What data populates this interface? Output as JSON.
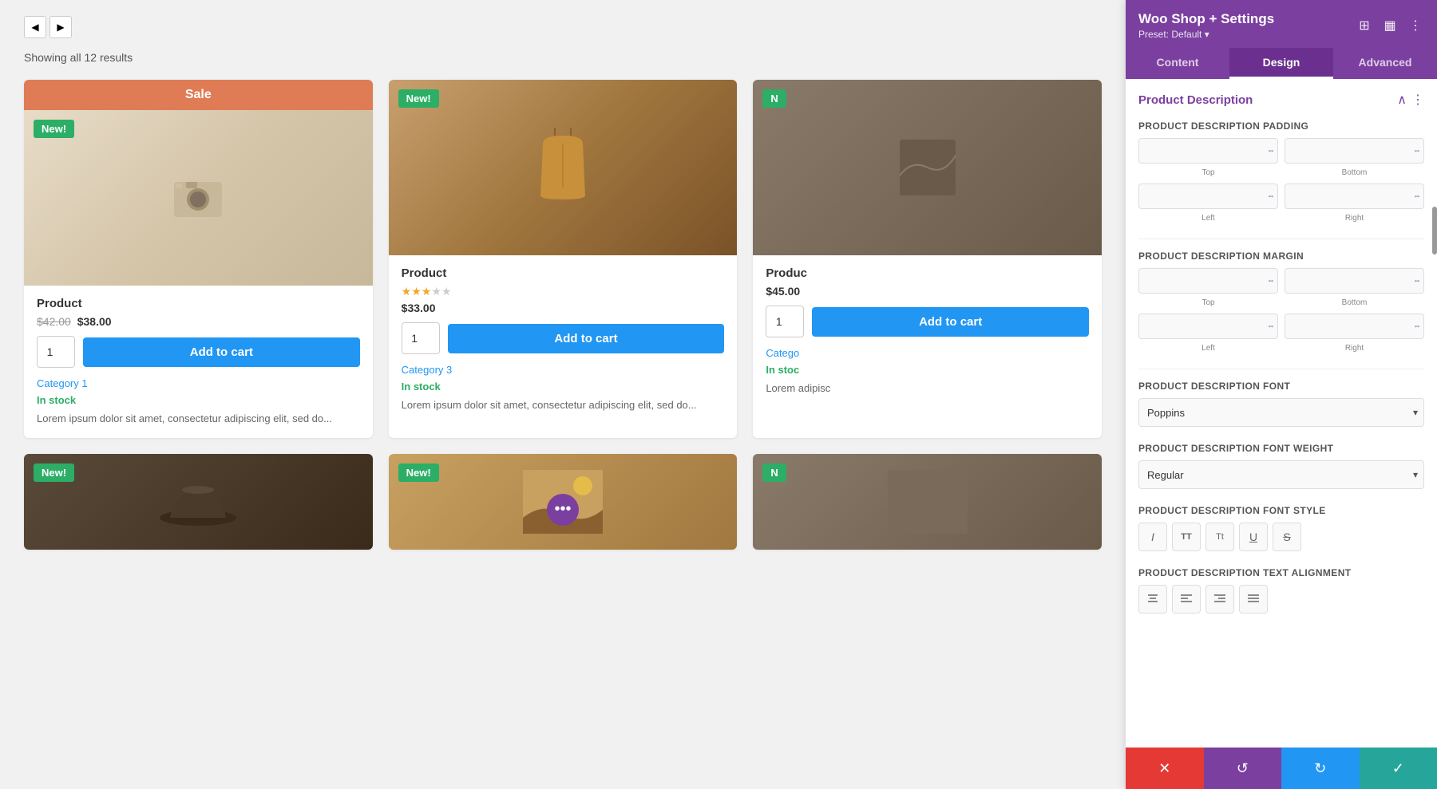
{
  "main": {
    "results_count": "Showing all 12 results",
    "pagination": [
      "◀",
      "▶"
    ]
  },
  "products": [
    {
      "id": "p1",
      "sale_banner": "Sale",
      "badge": "New!",
      "image_type": "camera",
      "name": "Product",
      "old_price": "$42.00",
      "new_price": "$38.00",
      "rating": null,
      "qty": "1",
      "add_to_cart": "Add to cart",
      "category": "Category 1",
      "stock": "In stock",
      "description": "Lorem ipsum dolor sit amet, consectetur adipiscing elit, sed do..."
    },
    {
      "id": "p2",
      "sale_banner": null,
      "badge": "New!",
      "image_type": "bag",
      "name": "Product",
      "old_price": null,
      "new_price": null,
      "regular_price": "$33.00",
      "rating": 3,
      "max_rating": 5,
      "qty": "1",
      "add_to_cart": "Add to cart",
      "category": "Category 3",
      "stock": "In stock",
      "description": "Lorem ipsum dolor sit amet, consectetur adipiscing elit, sed do..."
    },
    {
      "id": "p3",
      "sale_banner": null,
      "badge": "N",
      "image_type": "partial",
      "name": "Produc",
      "old_price": null,
      "new_price": null,
      "regular_price": "$45.00",
      "rating": null,
      "qty": "1",
      "add_to_cart": "Add to cart",
      "category": "Catego",
      "stock": "In stoc",
      "description": "Lorem adipisc"
    },
    {
      "id": "p4",
      "sale_banner": null,
      "badge": "New!",
      "image_type": "hat",
      "name": null,
      "regular_price": null,
      "partial": true
    },
    {
      "id": "p5",
      "sale_banner": null,
      "badge": "New!",
      "image_type": "landscape",
      "name": null,
      "regular_price": null,
      "partial": true
    },
    {
      "id": "p6",
      "sale_banner": null,
      "badge": "N",
      "image_type": "partial2",
      "name": null,
      "regular_price": null,
      "partial": true
    }
  ],
  "panel": {
    "title": "Woo Shop + Settings",
    "preset_label": "Preset: Default ▾",
    "tabs": [
      {
        "id": "content",
        "label": "Content"
      },
      {
        "id": "design",
        "label": "Design",
        "active": true
      },
      {
        "id": "advanced",
        "label": "Advanced"
      }
    ],
    "section": {
      "title": "Product Description",
      "fields": {
        "padding": {
          "label": "Product Description Padding",
          "top": "",
          "bottom": "",
          "left": "",
          "right": "",
          "sub_labels": [
            "Top",
            "Bottom",
            "Left",
            "Right"
          ]
        },
        "margin": {
          "label": "Product Description Margin",
          "top": "",
          "bottom": "",
          "left": "",
          "right": "",
          "sub_labels": [
            "Top",
            "Bottom",
            "Left",
            "Right"
          ]
        },
        "font": {
          "label": "Product Description Font",
          "value": "Poppins"
        },
        "font_weight": {
          "label": "Product Description Font Weight",
          "value": "Regular"
        },
        "font_style": {
          "label": "Product Description Font Style",
          "buttons": [
            {
              "id": "italic",
              "symbol": "I",
              "style": "italic"
            },
            {
              "id": "tt1",
              "symbol": "TT",
              "style": "bold"
            },
            {
              "id": "tt2",
              "symbol": "Tt",
              "style": "normal"
            },
            {
              "id": "underline",
              "symbol": "U",
              "style": "underline"
            },
            {
              "id": "strikethrough",
              "symbol": "S",
              "style": "strikethrough"
            }
          ]
        },
        "text_alignment": {
          "label": "Product Description Text Alignment",
          "buttons": [
            {
              "id": "center",
              "symbol": "≡",
              "align": "center"
            },
            {
              "id": "left",
              "symbol": "≡",
              "align": "left"
            },
            {
              "id": "right",
              "symbol": "≡",
              "align": "right"
            },
            {
              "id": "justify",
              "symbol": "≡",
              "align": "justify"
            }
          ]
        }
      }
    },
    "footer": {
      "cancel": "✕",
      "undo": "↺",
      "redo": "↻",
      "save": "✓"
    }
  }
}
